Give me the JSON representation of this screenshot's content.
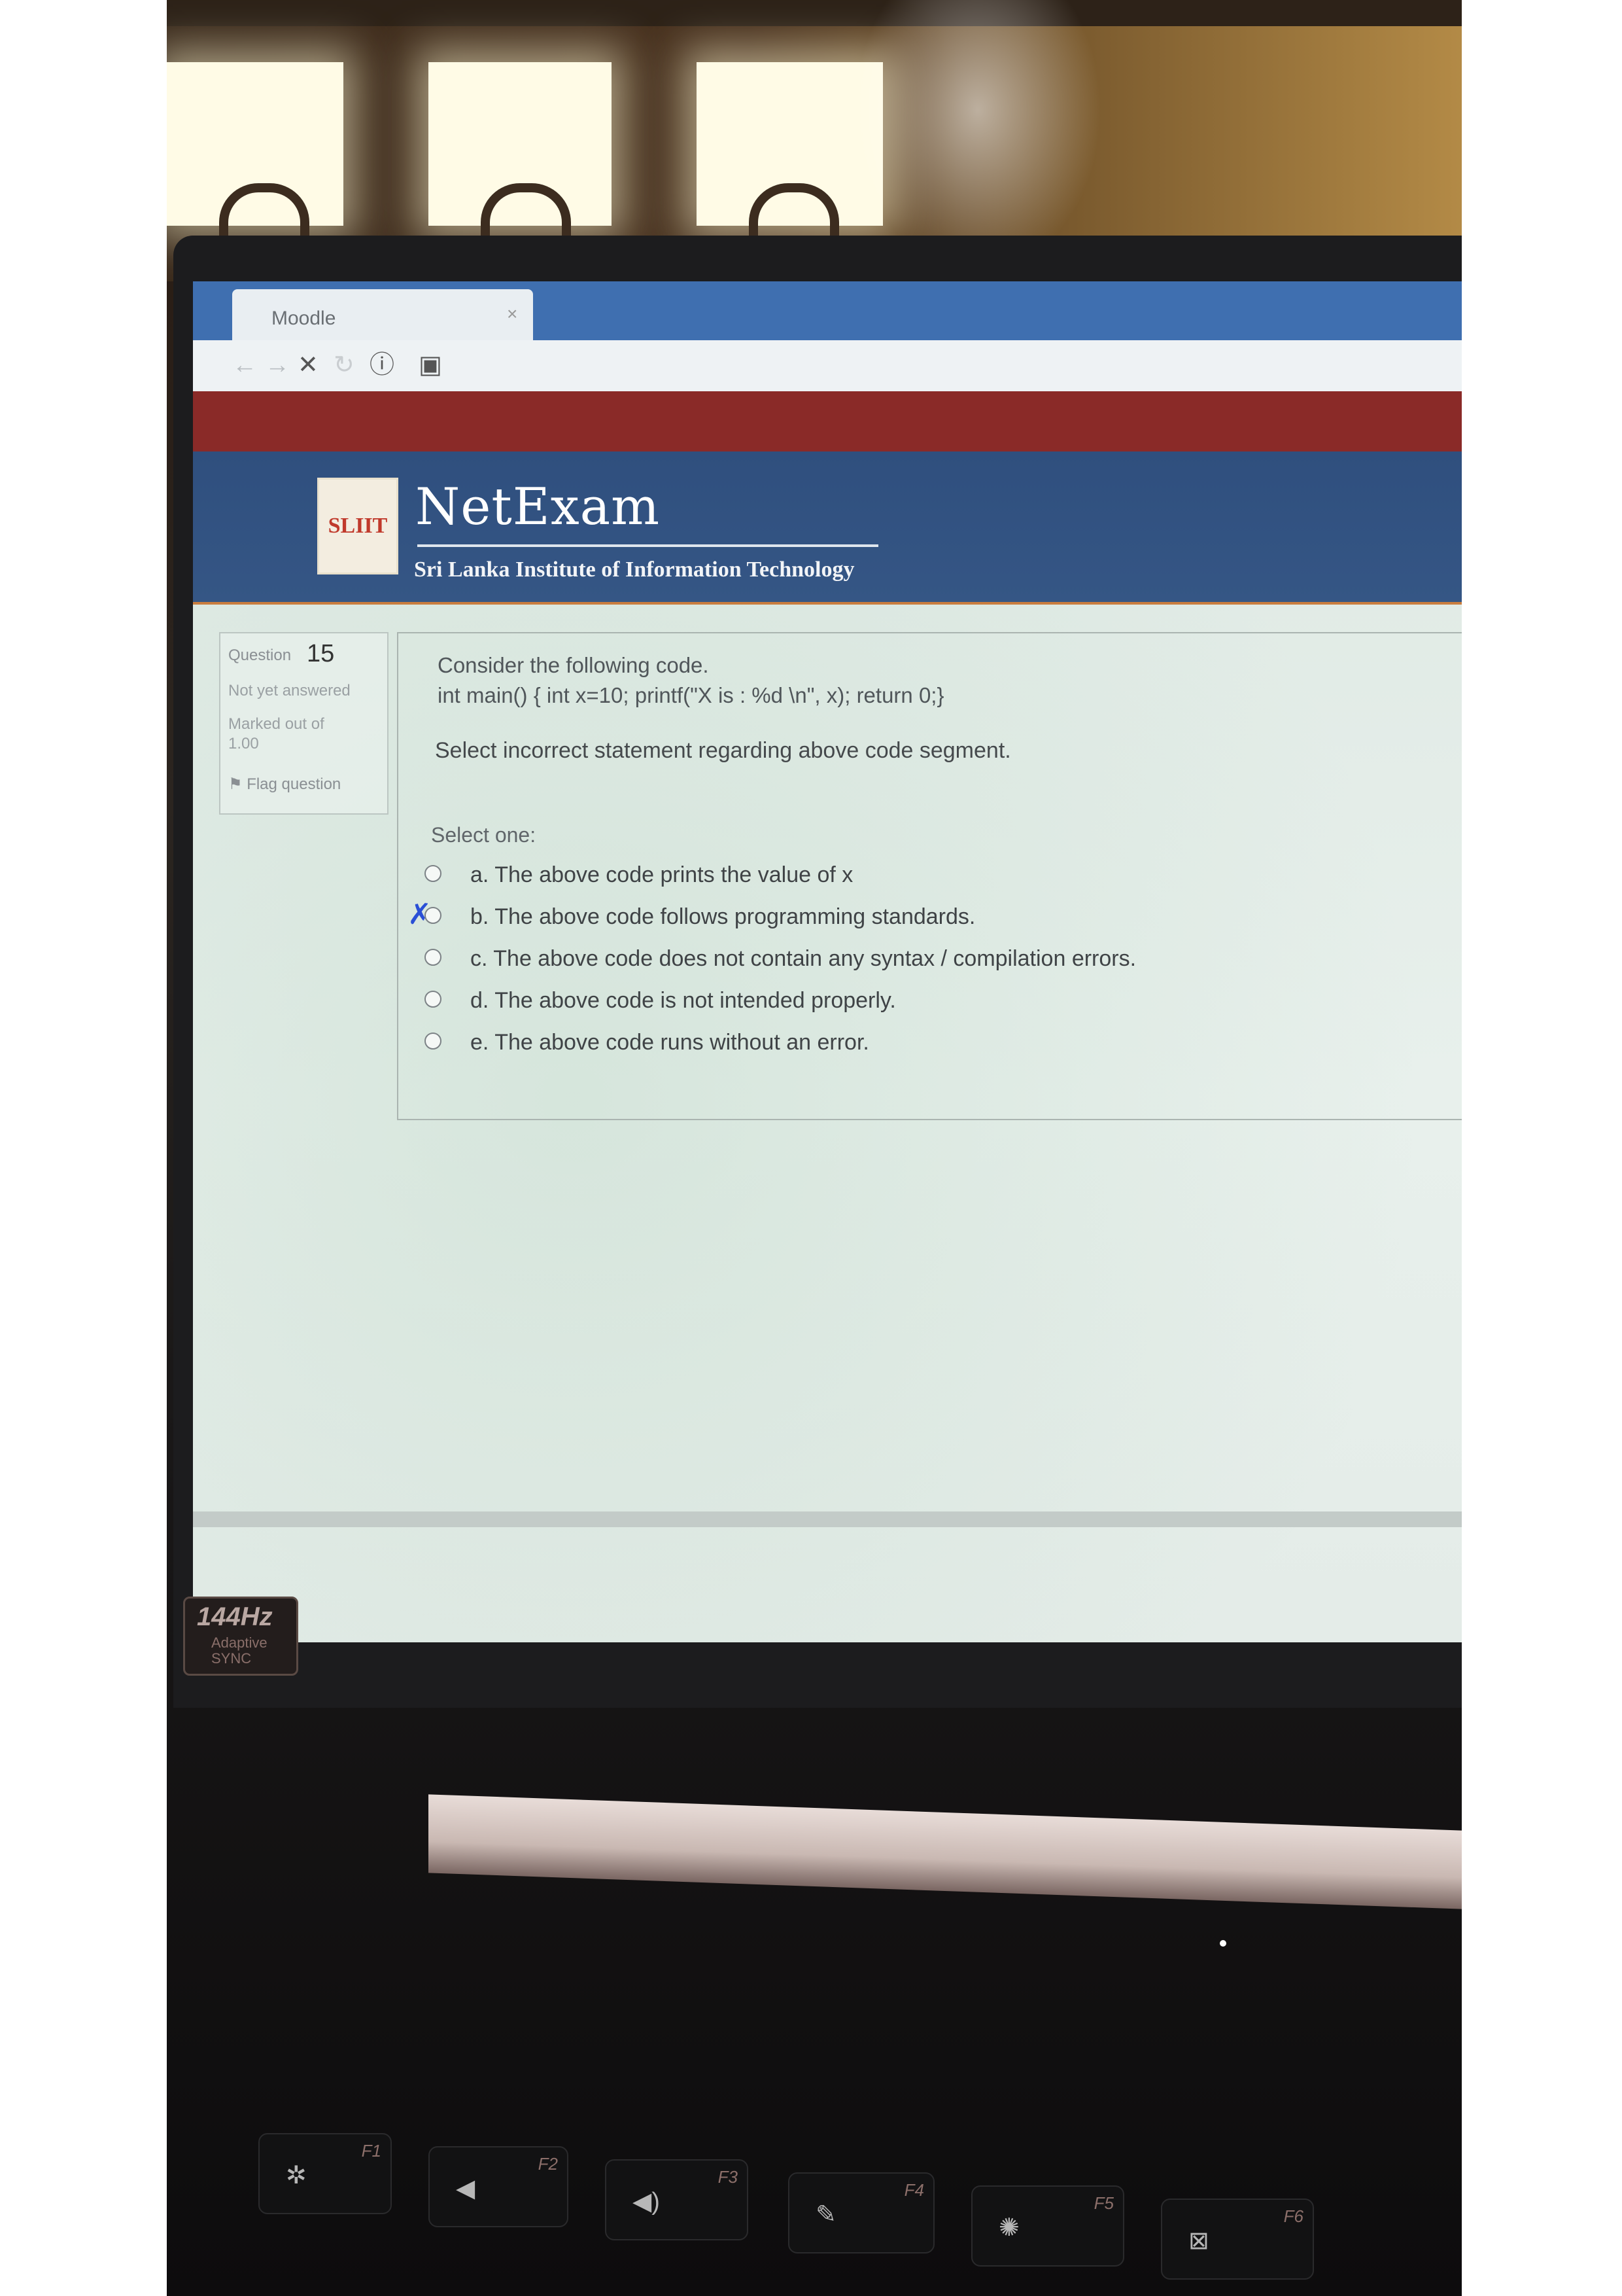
{
  "browser": {
    "tab_title": "Moodle",
    "tab_close": "×",
    "toolbar_icons": [
      "back-icon",
      "forward-icon",
      "stop-icon",
      "reload-icon",
      "info-icon",
      "page-icon"
    ]
  },
  "header": {
    "brand": "NetExam",
    "institute": "Sri Lanka Institute of Information Technology",
    "logo_text": "SLIIT"
  },
  "question_info": {
    "label": "Question",
    "number": "15",
    "state": "Not yet answered",
    "marked": "Marked out of 1.00",
    "flag": "Flag question"
  },
  "question": {
    "intro": "Consider the following code.",
    "code": "int main() { int x=10; printf(\"X is : %d \\n\", x); return 0;}",
    "prompt": "Select incorrect statement regarding above code segment.",
    "select_one": "Select one:",
    "options": [
      {
        "label": "a. The above code prints the value of x"
      },
      {
        "label": "b. The above code follows programming standards."
      },
      {
        "label": "c. The above code does not contain any syntax / compilation errors."
      },
      {
        "label": "d. The above code is not intended properly."
      },
      {
        "label": "e. The above code runs without an error."
      }
    ],
    "pen_mark": "✗"
  },
  "laptop": {
    "display_badge": "144Hz",
    "display_badge_sub": "Adaptive SYNC",
    "fkeys": [
      "F1",
      "F2",
      "F3",
      "F4",
      "F5",
      "F6"
    ]
  },
  "colors": {
    "tab_bar": "#3f6fb0",
    "red_bar": "#8a2a28",
    "banner": "#2f4f7e",
    "pen_mark": "#2a4fd6"
  }
}
